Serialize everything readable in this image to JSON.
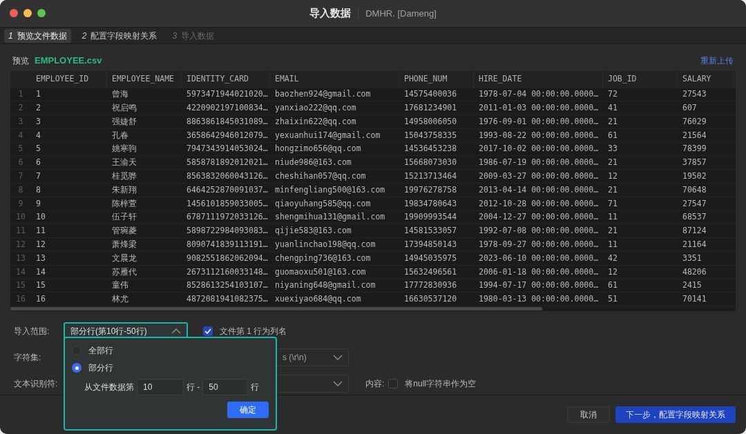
{
  "window": {
    "title": "导入数据",
    "subtitle": "DMHR. [Dameng]"
  },
  "steps": [
    {
      "number": "1",
      "label": "预览文件数据",
      "selected": true,
      "disabled": false
    },
    {
      "number": "2",
      "label": "配置字段映射关系",
      "selected": false,
      "disabled": false
    },
    {
      "number": "3",
      "label": "导入数据",
      "selected": false,
      "disabled": true
    }
  ],
  "preview": {
    "label": "预览",
    "file": "EMPLOYEE.csv",
    "reupload": "重新上传"
  },
  "table": {
    "columns": [
      "",
      "EMPLOYEE_ID",
      "EMPLOYEE_NAME",
      "IDENTITY_CARD",
      "EMAIL",
      "PHONE_NUM",
      "HIRE_DATE",
      "JOB_ID",
      "SALARY"
    ],
    "rows": [
      [
        "1",
        "1",
        "曾海",
        "5973471944021020…",
        "baozhen924@gmail.com",
        "14575400036",
        "1978-07-04 00:00:00.0000…",
        "72",
        "27543"
      ],
      [
        "2",
        "2",
        "祝启鸣",
        "4220902197100834…",
        "yanxiao222@qq.com",
        "17681234901",
        "2011-01-03 00:00:00.0000…",
        "41",
        "607"
      ],
      [
        "3",
        "3",
        "强婕舒",
        "8863861845031089…",
        "zhaixin622@qq.com",
        "14958006050",
        "1976-09-01 00:00:00.0000…",
        "21",
        "76029"
      ],
      [
        "4",
        "4",
        "孔春",
        "3658642946012079…",
        "yexuanhui174@gmail.com",
        "15043758335",
        "1993-08-22 00:00:00.0000…",
        "61",
        "21564"
      ],
      [
        "5",
        "5",
        "姚寒驹",
        "7947343914053024…",
        "hongzimo656@qq.com",
        "14536453238",
        "2017-10-02 00:00:00.0000…",
        "33",
        "78399"
      ],
      [
        "6",
        "6",
        "王渝天",
        "5858781892012021…",
        "niude986@163.com",
        "15668073030",
        "1986-07-19 00:00:00.0000…",
        "21",
        "37857"
      ],
      [
        "7",
        "7",
        "桂觅骅",
        "8563832060043126…",
        "cheshihan057@qq.com",
        "15213713464",
        "2009-03-27 00:00:00.0000…",
        "12",
        "19502"
      ],
      [
        "8",
        "8",
        "朱新翔",
        "6464252870091037…",
        "minfengliang500@163.com",
        "19976278758",
        "2013-04-14 00:00:00.0000…",
        "21",
        "70648"
      ],
      [
        "9",
        "9",
        "陈梓萱",
        "1456101859033005…",
        "qiaoyuhang585@qq.com",
        "19834780643",
        "2012-10-28 00:00:00.0000…",
        "71",
        "27547"
      ],
      [
        "10",
        "10",
        "伍子轩",
        "6787111972033126…",
        "shengmihua131@gmail.com",
        "19909993544",
        "2004-12-27 00:00:00.0000…",
        "11",
        "68537"
      ],
      [
        "11",
        "11",
        "管琬菱",
        "5898722984093083…",
        "qijie583@163.com",
        "14581533057",
        "1992-07-08 00:00:00.0000…",
        "21",
        "87124"
      ],
      [
        "12",
        "12",
        "萧烽梁",
        "8090741839113191…",
        "yuanlinchao198@qq.com",
        "17394850143",
        "1978-09-27 00:00:00.0000…",
        "11",
        "21164"
      ],
      [
        "13",
        "13",
        "文晨龙",
        "9082551862062094…",
        "chengping736@163.com",
        "14945035975",
        "2023-06-10 00:00:00.0000…",
        "42",
        "3351"
      ],
      [
        "14",
        "14",
        "苏雁代",
        "2673112160033148…",
        "guomaoxu501@163.com",
        "15632496561",
        "2006-01-18 00:00:00.0000…",
        "12",
        "48206"
      ],
      [
        "15",
        "15",
        "童伟",
        "8528613254103107…",
        "niyaning648@gmail.com",
        "17772830936",
        "1994-07-17 00:00:00.0000…",
        "61",
        "2415"
      ],
      [
        "16",
        "16",
        "林尤",
        "4872081941082375…",
        "xuexiyao684@qq.com",
        "16630537120",
        "1980-03-13 00:00:00.0000…",
        "51",
        "70141"
      ]
    ]
  },
  "form": {
    "range": {
      "label": "导入范围:",
      "value": "部分行(第10行-50行)",
      "expanded": true
    },
    "header_row": {
      "label": "文件第 1 行为列名",
      "checked": true
    },
    "charset": {
      "label": "字符集:"
    },
    "line_separator": {
      "value": "s (\\r\\n)"
    },
    "text_qualifier": {
      "label": "文本识别符:"
    },
    "content": {
      "label": "内容:"
    },
    "null_empty": {
      "label": "将null字符串作为空",
      "checked": false
    }
  },
  "range_popup": {
    "options": [
      {
        "label": "全部行",
        "selected": false
      },
      {
        "label": "部分行",
        "selected": true
      }
    ],
    "from_label": "从文件数据第",
    "from": "10",
    "middle": "行 -",
    "to": "50",
    "end": "行",
    "confirm": "确定"
  },
  "buttons": {
    "cancel": "取消",
    "next": "下一步，配置字段映射关系"
  }
}
